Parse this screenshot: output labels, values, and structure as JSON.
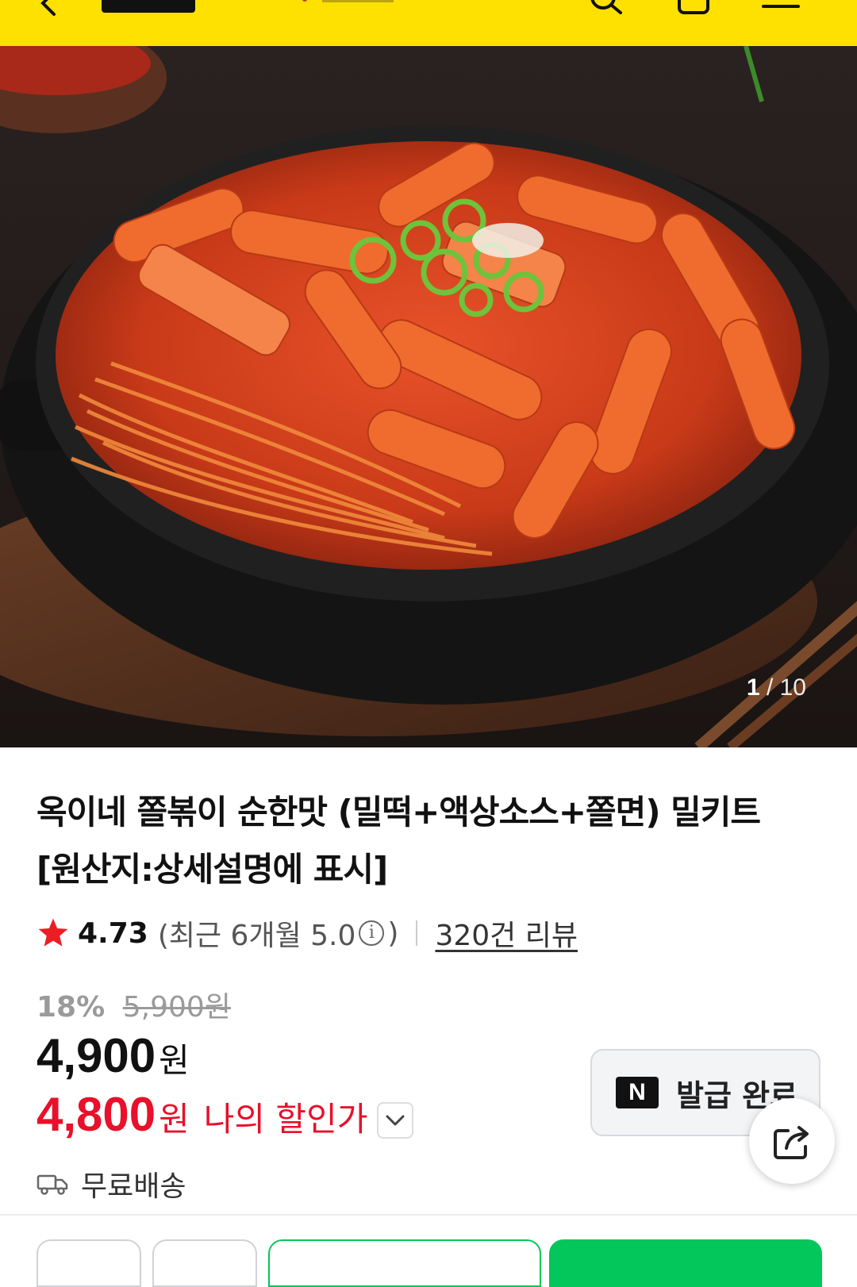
{
  "header": {
    "background_color": "#ffe100",
    "icons": [
      "back-icon",
      "logo",
      "search-icon",
      "cart-icon",
      "menu-icon"
    ]
  },
  "gallery": {
    "current": "1",
    "separator": "/",
    "total": "10"
  },
  "product": {
    "title_line1": "옥이네 쫄볶이 순한맛 (밀떡+액상소스+쫄면) 밀키트",
    "title_line2": "[원산지:상세설명에 표시]",
    "rating": "4.73",
    "recent_rating_prefix": "(최근 6개월 5.0",
    "recent_rating_suffix": ")",
    "review_count_label": "320건 리뷰"
  },
  "pricing": {
    "discount_rate": "18%",
    "original_price": "5,900원",
    "sale_price": "4,900",
    "currency": "원",
    "my_price": "4,800",
    "my_price_currency": "원",
    "my_price_label": "나의 할인가",
    "accent_color": "#e8102a"
  },
  "coupon": {
    "badge": "N",
    "label": "발급 완료"
  },
  "shipping": {
    "label": "무료배송"
  },
  "bottom_bar": {
    "buttons": [
      "icon-button-1",
      "icon-button-2",
      "outline-button",
      "primary-button"
    ],
    "primary_color": "#03c75a"
  }
}
